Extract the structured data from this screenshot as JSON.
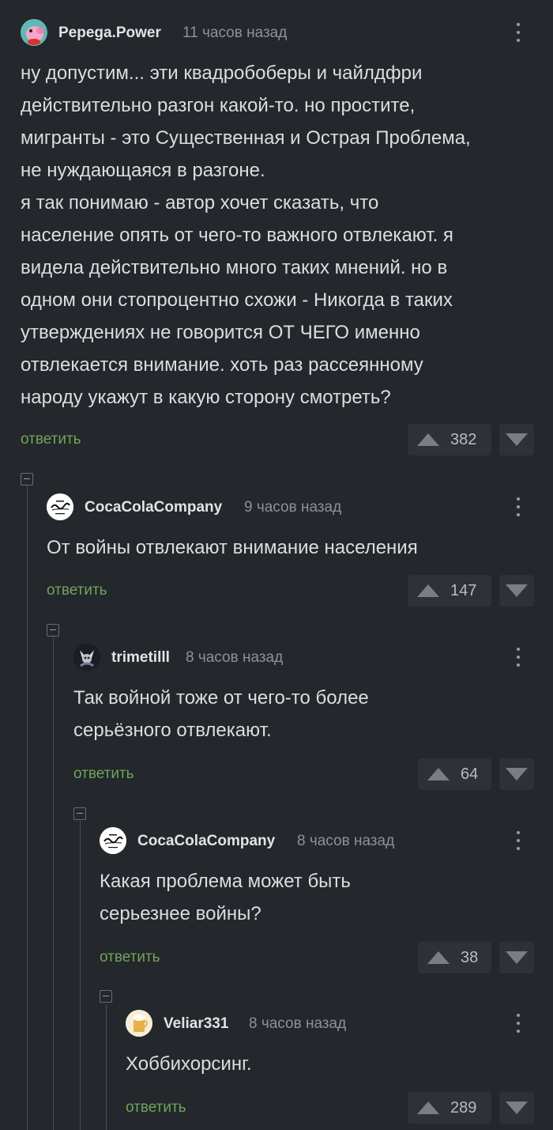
{
  "reply_label": "ответить",
  "comments": [
    {
      "username": "Pepega.Power",
      "time": "11 часов назад",
      "text": "ну допустим... эти квадробоберы и чайлдфри\nдействительно разгон какой-то. но простите,\nмигранты - это Существенная и Острая Проблема,\nне нуждающаяся в разгоне.\nя так понимаю - автор хочет сказать, что\nнаселение опять от чего-то важного отвлекают. я\nвидела действительно много таких мнений. но в\nодном они стопроцентно схожи - Никогда в таких\nутверждениях не говорится ОТ ЧЕГО именно\nотвлекается внимание. хоть раз рассеянному\nнароду укажут в какую сторону смотреть?",
      "rating": "382",
      "avatar_icon": "peppa-pig-avatar"
    },
    {
      "username": "CocaColaCompany",
      "time": "9 часов назад",
      "text": "От войны отвлекают внимание населения",
      "rating": "147",
      "avatar_icon": "coca-cola-logo-avatar"
    },
    {
      "username": "trimetilll",
      "time": "8 часов назад",
      "text": "Так войной тоже от чего-то более\nсерьёзного отвлекают.",
      "rating": "64",
      "avatar_icon": "dark-character-avatar"
    },
    {
      "username": "CocaColaCompany",
      "time": "8 часов назад",
      "text": "Какая проблема может быть\nсерьезнее войны?",
      "rating": "38",
      "avatar_icon": "coca-cola-logo-avatar"
    },
    {
      "username": "Veliar331",
      "time": "8 часов назад",
      "text": "Хоббихорсинг.",
      "rating": "289",
      "avatar_icon": "beer-glass-avatar"
    }
  ]
}
